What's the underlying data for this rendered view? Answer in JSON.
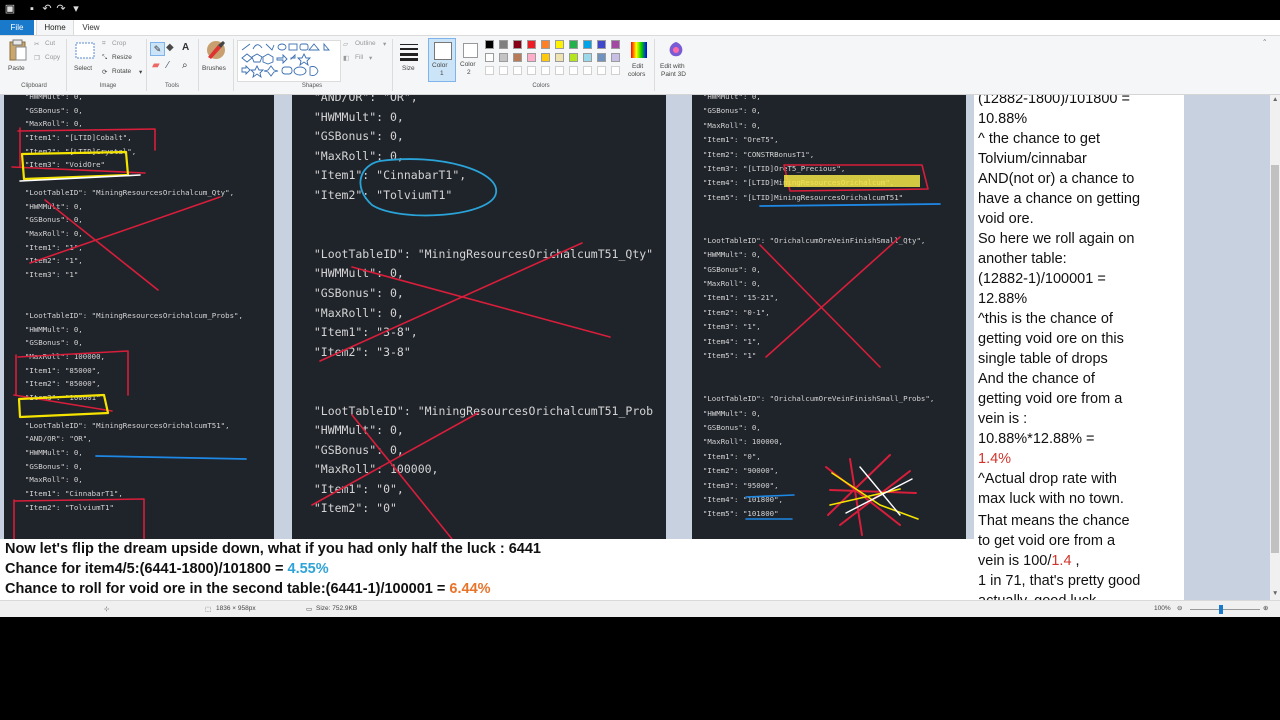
{
  "window": {
    "tabs": {
      "file": "File",
      "home": "Home",
      "view": "View"
    }
  },
  "ribbon": {
    "clipboard": {
      "paste": "Paste",
      "cut": "Cut",
      "copy": "Copy",
      "label": "Clipboard"
    },
    "image": {
      "select": "Select",
      "crop": "Crop",
      "resize": "Resize",
      "rotate": "Rotate",
      "label": "Image"
    },
    "tools": {
      "label": "Tools"
    },
    "brushes": {
      "label": "Brushes"
    },
    "shapes": {
      "outline": "Outline",
      "fill": "Fill",
      "label": "Shapes"
    },
    "size": {
      "label": "Size"
    },
    "color1": {
      "label": "Color",
      "num": "1"
    },
    "color2": {
      "label": "Color",
      "num": "2"
    },
    "colors": {
      "label": "Colors"
    },
    "edit_colors": {
      "line1": "Edit",
      "line2": "colors"
    },
    "paint3d": {
      "line1": "Edit with",
      "line2": "Paint 3D"
    },
    "palette": [
      "#000000",
      "#7f7f7f",
      "#880015",
      "#ed1c24",
      "#ff7f27",
      "#fff200",
      "#22b14c",
      "#00a2e8",
      "#3f48cc",
      "#a349a4",
      "#ffffff",
      "#c3c3c3",
      "#b97a57",
      "#ffaec9",
      "#ffc90e",
      "#efe4b0",
      "#b5e61d",
      "#99d9ea",
      "#7092be",
      "#c8bfe7"
    ]
  },
  "panels": {
    "left": [
      "  \"HWMMult\": 0,",
      "  \"GSBonus\": 0,",
      "  \"MaxRoll\": 0,",
      "  \"Item1\": \"[LTID]Cobalt\",",
      "  \"Item2\": \"[LTID]Crystal\",",
      "  \"Item3\": \"VoidOre\"",
      "",
      "  \"LootTableID\": \"MiningResourcesOrichalcum_Qty\",",
      "  \"HWMMult\": 0,",
      "  \"GSBonus\": 0,",
      "  \"MaxRoll\": 0,",
      "  \"Item1\": \"1\",",
      "  \"Item2\": \"1\",",
      "  \"Item3\": \"1\"",
      "",
      "",
      "  \"LootTableID\": \"MiningResourcesOrichalcum_Probs\",",
      "  \"HWMMult\": 0,",
      "  \"GSBonus\": 0,",
      "  \"MaxRoll\": 100000,",
      "  \"Item1\": \"85000\",",
      "  \"Item2\": \"85000\",",
      "  \"Item3\": \"100001\"",
      "",
      "  \"LootTableID\": \"MiningResourcesOrichalcumT51\",",
      "  \"AND/OR\": \"OR\",",
      "  \"HWMMult\": 0,",
      "  \"GSBonus\": 0,",
      "  \"MaxRoll\": 0,",
      "  \"Item1\": \"CinnabarT1\",",
      "  \"Item2\": \"TolviumT1\""
    ],
    "middle": [
      "  \"AND/OR\": \"OR\",",
      "  \"HWMMult\": 0,",
      "  \"GSBonus\": 0,",
      "  \"MaxRoll\": 0,",
      "  \"Item1\": \"CinnabarT1\",",
      "  \"Item2\": \"TolviumT1\"",
      "",
      "",
      "  \"LootTableID\": \"MiningResourcesOrichalcumT51_Qty\"",
      "  \"HWMMult\": 0,",
      "  \"GSBonus\": 0,",
      "  \"MaxRoll\": 0,",
      "  \"Item1\": \"3-8\",",
      "  \"Item2\": \"3-8\"",
      "",
      "",
      "  \"LootTableID\": \"MiningResourcesOrichalcumT51_Prob",
      "  \"HWMMult\": 0,",
      "  \"GSBonus\": 0,",
      "  \"MaxRoll\": 100000,",
      "  \"Item1\": \"0\",",
      "  \"Item2\": \"0\""
    ],
    "right": [
      "  \"HWMMult\": 0,",
      "  \"GSBonus\": 0,",
      "  \"MaxRoll\": 0,",
      "  \"Item1\": \"OreT5\",",
      "  \"Item2\": \"CONSTRBonusT1\",",
      "  \"Item3\": \"[LTID]OreT5_Precious\",",
      "  \"Item4\": \"[LTID]MiningResourcesOrichalcum\",",
      "  \"Item5\": \"[LTID]MiningResourcesOrichalcumT51\"",
      "",
      "",
      "  \"LootTableID\": \"OrichalcumOreVeinFinishSmall_Qty\",",
      "  \"HWMMult\": 0,",
      "  \"GSBonus\": 0,",
      "  \"MaxRoll\": 0,",
      "  \"Item1\": \"15-21\",",
      "  \"Item2\": \"0-1\",",
      "  \"Item3\": \"1\",",
      "  \"Item4\": \"1\",",
      "  \"Item5\": \"1\"",
      "",
      "",
      "  \"LootTableID\": \"OrichalcumOreVeinFinishSmall_Probs\",",
      "  \"HWMMult\": 0,",
      "  \"GSBonus\": 0,",
      "  \"MaxRoll\": 100000,",
      "  \"Item1\": \"0\",",
      "  \"Item2\": \"90000\",",
      "  \"Item3\": \"95000\",",
      "  \"Item4\": \"101800\",",
      "  \"Item5\": \"101800\""
    ]
  },
  "notes_right": [
    {
      "text": "(12882-1800)/101800 =",
      "color": "#111111",
      "bold": false
    },
    {
      "text": "10.88%",
      "color": "#111111",
      "bold": false
    },
    {
      "text": "^ the chance to get",
      "color": "#111111",
      "bold": false
    },
    {
      "text": "Tolvium/cinnabar",
      "color": "#111111",
      "bold": false
    },
    {
      "text": "AND(not or) a chance to",
      "color": "#111111",
      "bold": false
    },
    {
      "text": "have a chance on getting",
      "color": "#111111",
      "bold": false
    },
    {
      "text": "void ore.",
      "color": "#111111",
      "bold": false
    },
    {
      "text": "So here we roll again on",
      "color": "#111111",
      "bold": false
    },
    {
      "text": "another table:",
      "color": "#111111",
      "bold": false
    },
    {
      "text": "(12882-1)/100001 =",
      "color": "#111111",
      "bold": false
    },
    {
      "text": "12.88%",
      "color": "#111111",
      "bold": false
    },
    {
      "text": "^this is the chance of",
      "color": "#111111",
      "bold": false
    },
    {
      "text": "getting void ore on this",
      "color": "#111111",
      "bold": false
    },
    {
      "text": "single table of drops",
      "color": "#111111",
      "bold": false
    },
    {
      "text": "And the chance of",
      "color": "#111111",
      "bold": false
    },
    {
      "text": "getting void ore from a",
      "color": "#111111",
      "bold": false
    },
    {
      "text": "vein is :",
      "color": "#111111",
      "bold": false
    },
    {
      "text": "10.88%*12.88% =",
      "color": "#111111",
      "bold": false
    },
    {
      "text": "1.4%",
      "color": "#d0342c",
      "bold": false
    },
    {
      "text": "^Actual drop rate with",
      "color": "#111111",
      "bold": false
    },
    {
      "text": "max luck with no town.",
      "color": "#111111",
      "bold": false
    }
  ],
  "notes_right_2": {
    "l1": "That means the chance",
    "l2": "to get void ore from a",
    "l3a": "vein is 100/",
    "l3b": "1.4",
    "l3c": " ,",
    "l4": "1 in 71, that's pretty good",
    "l5": "actually, good luck"
  },
  "bottom_notes": {
    "line1": "Now let's flip the dream upside down, what if you had only half the luck : 6441",
    "line2a": "Chance for item4/5:(6441-1800)/101800 = ",
    "line2b": "4.55%",
    "line3a": "Chance to roll for void ore in the second table:(6441-1)/100001 = ",
    "line3b": "6.44%"
  },
  "status": {
    "dimensions": "1836 × 958px",
    "size": "Size: 752.9KB",
    "zoom": "100%"
  }
}
